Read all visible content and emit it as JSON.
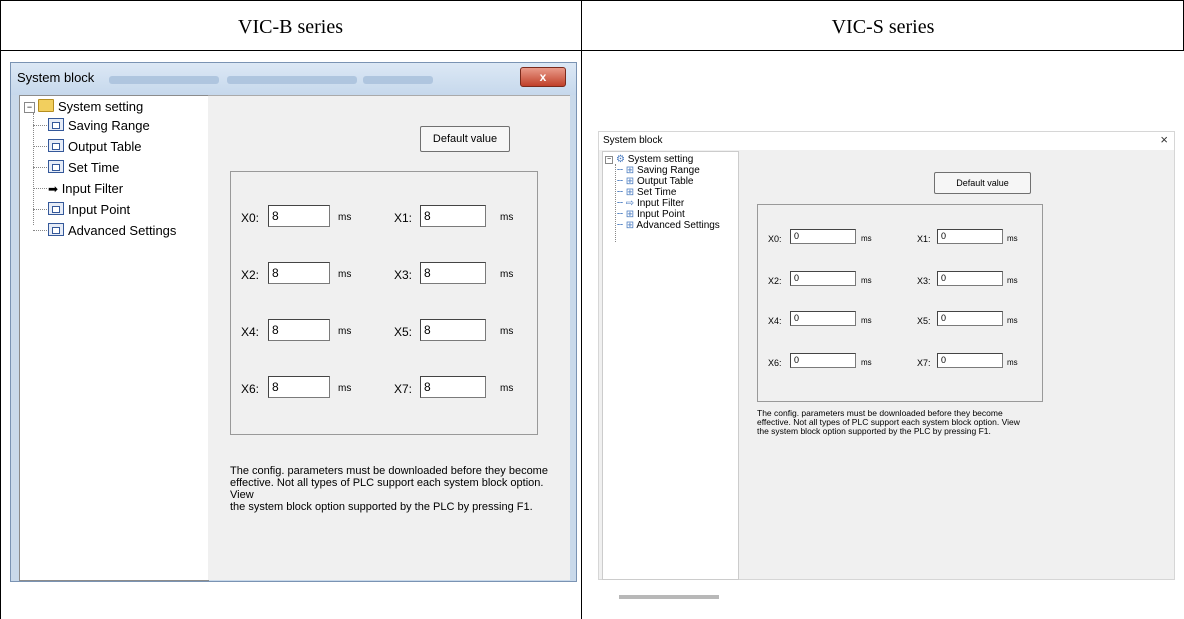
{
  "columns": {
    "left_header": "VIC-B series",
    "right_header": "VIC-S series"
  },
  "vicb": {
    "title": "System block",
    "close_label": "x",
    "tree": {
      "root": "System setting",
      "items": [
        "Saving Range",
        "Output Table",
        "Set Time",
        "Input Filter",
        "Input Point",
        "Advanced Settings"
      ]
    },
    "default_button": "Default value",
    "unit": "ms",
    "fields": [
      {
        "label": "X0:",
        "value": "8"
      },
      {
        "label": "X1:",
        "value": "8"
      },
      {
        "label": "X2:",
        "value": "8"
      },
      {
        "label": "X3:",
        "value": "8"
      },
      {
        "label": "X4:",
        "value": "8"
      },
      {
        "label": "X5:",
        "value": "8"
      },
      {
        "label": "X6:",
        "value": "8"
      },
      {
        "label": "X7:",
        "value": "8"
      }
    ],
    "note_lines": [
      "The config. parameters must be downloaded before they become",
      "effective. Not all types of PLC support each system block option. View",
      "the system block option supported by the PLC by pressing F1."
    ]
  },
  "vics": {
    "title": "System block",
    "close_label": "×",
    "tree": {
      "root": "System setting",
      "items": [
        "Saving Range",
        "Output Table",
        "Set Time",
        "Input Filter",
        "Input Point",
        "Advanced Settings"
      ]
    },
    "default_button": "Default value",
    "unit": "ms",
    "fields": [
      {
        "label": "X0:",
        "value": "0"
      },
      {
        "label": "X1:",
        "value": "0"
      },
      {
        "label": "X2:",
        "value": "0"
      },
      {
        "label": "X3:",
        "value": "0"
      },
      {
        "label": "X4:",
        "value": "0"
      },
      {
        "label": "X5:",
        "value": "0"
      },
      {
        "label": "X6:",
        "value": "0"
      },
      {
        "label": "X7:",
        "value": "0"
      }
    ],
    "note_lines": [
      "The config. parameters must be downloaded before they become",
      "effective. Not all types of PLC support each system block option. View",
      "the system block option supported by the PLC by pressing F1."
    ]
  }
}
